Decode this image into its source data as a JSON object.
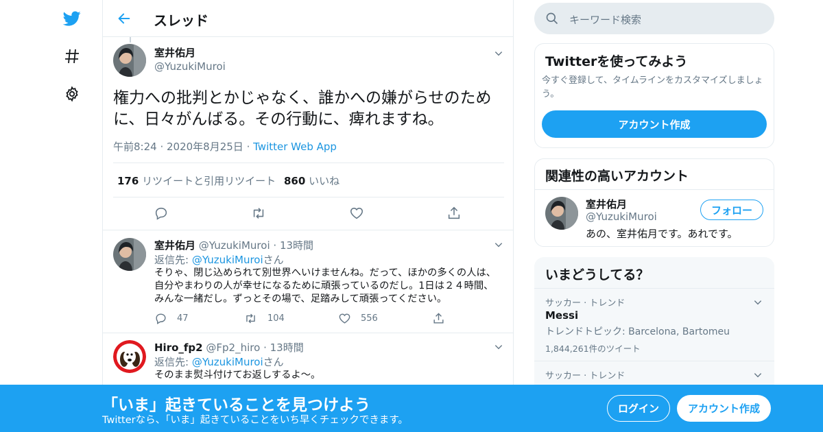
{
  "nav": {
    "icons": [
      "twitter-logo-icon",
      "hashtag-icon",
      "gear-icon"
    ]
  },
  "header": {
    "title": "スレッド"
  },
  "focus_tweet": {
    "name": "室井佑月",
    "handle": "@YuzukiMuroi",
    "text": "権力への批判とかじゃなく、誰かへの嫌がらせのために、日々がんばる。その行動に、痺れますね。",
    "time": "午前8:24",
    "date": "2020年8月25日",
    "source": "Twitter Web App",
    "retweets": "176",
    "retweets_label": "リツイートと引用リツイート",
    "likes": "860",
    "likes_label": "いいね"
  },
  "replies": [
    {
      "name": "室井佑月",
      "handle": "@YuzukiMuroi",
      "time": "13時間",
      "reply_prefix": "返信先: ",
      "reply_to": "@YuzukiMuroi",
      "reply_suffix": "さん",
      "text": "そりゃ、閉じ込められて別世界へいけませんね。だって、ほかの多くの人は、自分やまわりの人が幸せになるために頑張っているのだし。1日は２４時間、みんな一緒だし。ずっとその場で、足踏みして頑張ってください。",
      "replies": "47",
      "retweets": "104",
      "likes": "556"
    },
    {
      "name": "Hiro_fp2",
      "handle": "@Fp2_hiro",
      "time": "13時間",
      "reply_prefix": "返信先: ",
      "reply_to": "@YuzukiMuroi",
      "reply_suffix": "さん",
      "text": "そのまま熨斗付けてお返しするよ〜。"
    }
  ],
  "search": {
    "placeholder": "キーワード検索"
  },
  "signup_card": {
    "title": "Twitterを使ってみよう",
    "desc": "今すぐ登録して、タイムラインをカスタマイズしましょう。",
    "button": "アカウント作成"
  },
  "related_card": {
    "title": "関連性の高いアカウント",
    "name": "室井佑月",
    "handle": "@YuzukiMuroi",
    "bio": "あの、室井佑月です。あれです。",
    "follow": "フォロー"
  },
  "trends": {
    "title": "いまどうしてる？",
    "items": [
      {
        "category": "サッカー · トレンド",
        "name": "Messi",
        "sub": "トレンドトピック: Barcelona, Bartomeu",
        "count": "1,844,261件のツイート"
      },
      {
        "category": "サッカー · トレンド"
      }
    ]
  },
  "banner": {
    "headline": "「いま」起きていることを見つけよう",
    "subline": "Twitterなら、「いま」起きていることをいち早くチェックできます。",
    "login": "ログイン",
    "signup": "アカウント作成"
  },
  "colors": {
    "brand": "#1da1f2",
    "link": "#1b95e0",
    "muted": "#657786"
  }
}
